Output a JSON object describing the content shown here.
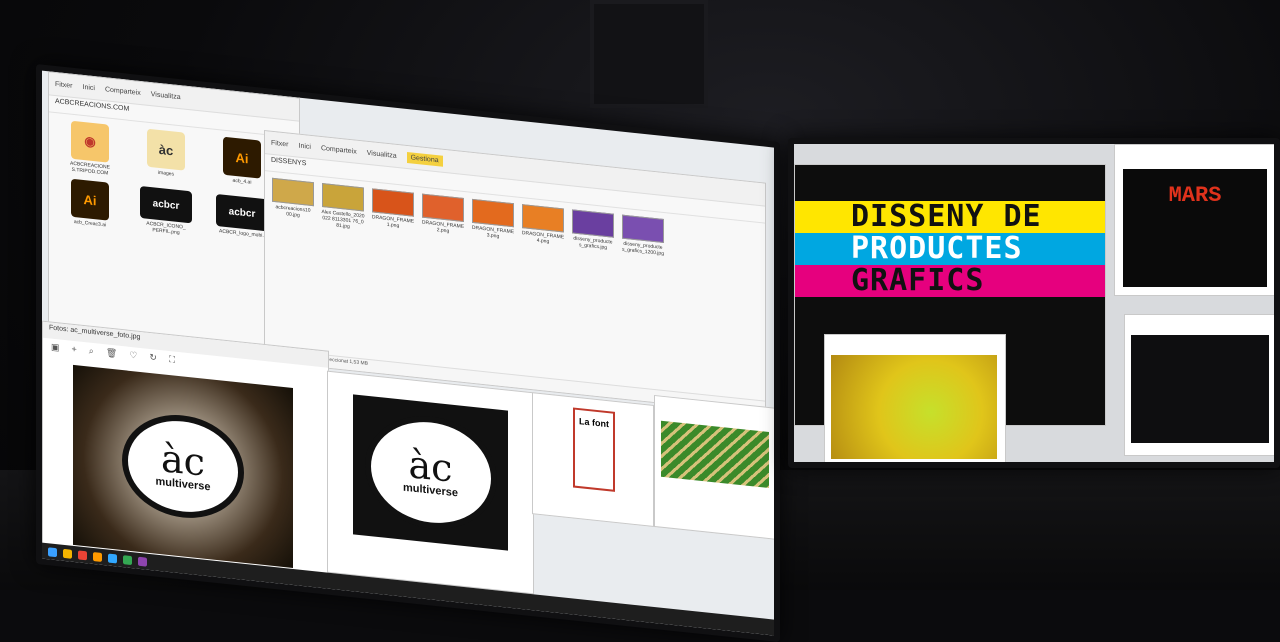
{
  "explorer_back": {
    "ribbon_tabs": [
      "Fitxer",
      "Inici",
      "Comparteix",
      "Visualitza"
    ],
    "path": "ACBCREACIONS.COM",
    "items": [
      {
        "label": "ACBCREACIONE S.TRIPOD.COM"
      },
      {
        "label": "images"
      },
      {
        "label": "acb_4.ai"
      },
      {
        "label": "acb_Creac3.ai"
      },
      {
        "label": "ACBCR_ICONO_ PERFIL.png"
      },
      {
        "label": "ACBCR_logo_mobi.JPG"
      }
    ]
  },
  "explorer_front": {
    "ribbon_tabs": [
      "Fitxer",
      "Inici",
      "Comparteix",
      "Visualitza",
      "Gestiona"
    ],
    "path": "DISSENYS",
    "selected_tab": "Gestiona",
    "thumbs": [
      {
        "label": "acbcreacions10 00.jpg",
        "color": "#cfa84a"
      },
      {
        "label": "Alex Castello_2020 022 8113301 76_0 81.jpg",
        "color": "#c9a43a"
      },
      {
        "label": "DRAGON_FRAME 1.png",
        "color": "#d8541a"
      },
      {
        "label": "DRAGON_FRAME 2.png",
        "color": "#e0612c"
      },
      {
        "label": "DRAGON_FRAME 3.png",
        "color": "#e36a1e"
      },
      {
        "label": "DRAGON_FRAME 4.png",
        "color": "#e87f24"
      },
      {
        "label": "disseny_producte s_grafics.jpg",
        "color": "#6a3fa0"
      },
      {
        "label": "disseny_producte s_grafics_1200.jpg",
        "color": "#7a4fb0"
      }
    ],
    "status": "75 elements   1 element seleccionat  1,53 MB"
  },
  "photo_left": {
    "title": "Fotos: ac_multiverse_foto.jpg",
    "logo_main": "àc",
    "logo_sub": "multiverse"
  },
  "photo_mid": {
    "logo_main": "àc",
    "logo_sub": "multiverse"
  },
  "book": {
    "title": "La font"
  },
  "right_monitor": {
    "banner_lines": [
      "DISSENY DE",
      "PRODUCTES",
      "GRAFICS"
    ],
    "mars_label": "MARS"
  },
  "colors": {
    "magenta": "#e6007e",
    "yellow": "#ffe600",
    "cyan": "#00a7e1",
    "accent_gold": "#f4d03f"
  }
}
